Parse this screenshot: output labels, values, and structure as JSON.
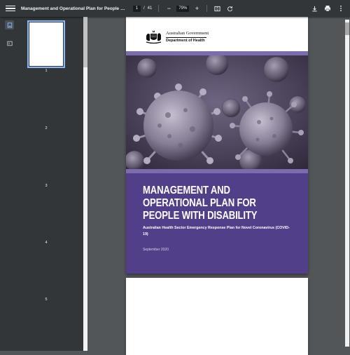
{
  "toolbar": {
    "title": "Management and Operational Plan for People with Disabi...",
    "page_current": "1",
    "page_separator": "/",
    "page_total": "41",
    "zoom_out_label": "−",
    "zoom": "79%",
    "zoom_in_label": "+",
    "icons": [
      "menu-icon",
      "fit-page-icon",
      "rotate-icon",
      "download-icon",
      "print-icon",
      "more-vert-icon"
    ]
  },
  "sidebar": {
    "tabs": [
      {
        "icon": "thumbnails-icon",
        "active": true
      },
      {
        "icon": "outline-icon",
        "active": false
      }
    ],
    "thumbnails": [
      {
        "label": "1",
        "active": true
      },
      {
        "label": "2",
        "active": false
      },
      {
        "label": "3",
        "active": false
      },
      {
        "label": "4",
        "active": false
      },
      {
        "label": "5",
        "active": false
      }
    ]
  },
  "document": {
    "gov_name": "Australian Government",
    "department": "Department of Health",
    "cover_title": "MANAGEMENT AND OPERATIONAL PLAN FOR PEOPLE WITH DISABILITY",
    "cover_subtitle": "Australian Health Sector Emergency Response Plan for Novel Coronavirus (COVID-19)",
    "cover_date": "September 2020",
    "colors": {
      "purple": "#523f8a",
      "lavender_band": "#7d6bb0"
    }
  }
}
